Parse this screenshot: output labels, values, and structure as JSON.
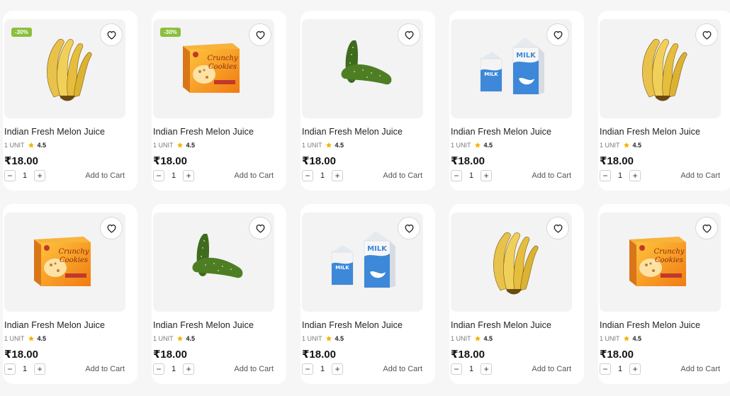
{
  "colors": {
    "badge": "#8bbf3c",
    "star": "#f5b301",
    "card": "#ffffff",
    "image_bg": "#f3f3f3"
  },
  "products": [
    {
      "image": "banana",
      "discount": "-30%",
      "title": "Indian Fresh Melon Juice",
      "unit": "1 UNIT",
      "rating": "4.5",
      "price": "₹18.00",
      "qty": "1",
      "minus": "−",
      "plus": "+",
      "cart": "Add to Cart"
    },
    {
      "image": "crunchy-box",
      "discount": "-30%",
      "title": "Indian Fresh Melon Juice",
      "unit": "1 UNIT",
      "rating": "4.5",
      "price": "₹18.00",
      "qty": "1",
      "minus": "−",
      "plus": "+",
      "cart": "Add to Cart"
    },
    {
      "image": "cucumber",
      "discount": "",
      "title": "Indian Fresh Melon Juice",
      "unit": "1 UNIT",
      "rating": "4.5",
      "price": "₹18.00",
      "qty": "1",
      "minus": "−",
      "plus": "+",
      "cart": "Add to Cart"
    },
    {
      "image": "milk",
      "discount": "",
      "title": "Indian Fresh Melon Juice",
      "unit": "1 UNIT",
      "rating": "4.5",
      "price": "₹18.00",
      "qty": "1",
      "minus": "−",
      "plus": "+",
      "cart": "Add to Cart"
    },
    {
      "image": "banana",
      "discount": "",
      "title": "Indian Fresh Melon Juice",
      "unit": "1 UNIT",
      "rating": "4.5",
      "price": "₹18.00",
      "qty": "1",
      "minus": "−",
      "plus": "+",
      "cart": "Add to Cart"
    },
    {
      "image": "crunchy-box",
      "discount": "",
      "title": "Indian Fresh Melon Juice",
      "unit": "1 UNIT",
      "rating": "4.5",
      "price": "₹18.00",
      "qty": "1",
      "minus": "−",
      "plus": "+",
      "cart": "Add to Cart"
    },
    {
      "image": "cucumber",
      "discount": "",
      "title": "Indian Fresh Melon Juice",
      "unit": "1 UNIT",
      "rating": "4.5",
      "price": "₹18.00",
      "qty": "1",
      "minus": "−",
      "plus": "+",
      "cart": "Add to Cart"
    },
    {
      "image": "milk",
      "discount": "",
      "title": "Indian Fresh Melon Juice",
      "unit": "1 UNIT",
      "rating": "4.5",
      "price": "₹18.00",
      "qty": "1",
      "minus": "−",
      "plus": "+",
      "cart": "Add to Cart"
    },
    {
      "image": "banana",
      "discount": "",
      "title": "Indian Fresh Melon Juice",
      "unit": "1 UNIT",
      "rating": "4.5",
      "price": "₹18.00",
      "qty": "1",
      "minus": "−",
      "plus": "+",
      "cart": "Add to Cart"
    },
    {
      "image": "crunchy-box",
      "discount": "",
      "title": "Indian Fresh Melon Juice",
      "unit": "1 UNIT",
      "rating": "4.5",
      "price": "₹18.00",
      "qty": "1",
      "minus": "−",
      "plus": "+",
      "cart": "Add to Cart"
    }
  ]
}
